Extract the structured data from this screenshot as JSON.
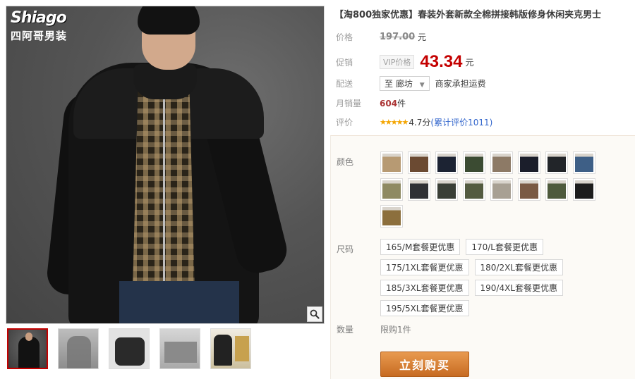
{
  "gallery": {
    "logo_mark": "Shiago",
    "logo_cn": "四阿哥男装",
    "zoom_icon": "magnifier-icon",
    "thumbnails": [
      "thumb-1",
      "thumb-2",
      "thumb-3",
      "thumb-4",
      "thumb-5"
    ],
    "active_thumb": 0
  },
  "product": {
    "title": "【淘800独家优惠】春装外套新款全棉拼接韩版修身休闲夹克男士",
    "price_label": "价格",
    "original_price": "197.00",
    "currency_unit": "元",
    "promo_label": "促销",
    "vip_tag": "VIP价格",
    "promo_price": "43.34",
    "ship_label": "配送",
    "ship_prefix": "至",
    "ship_dest": "廊坊",
    "ship_note": "商家承担运费",
    "sales_label": "月销量",
    "sales_count": "604",
    "sales_unit": "件",
    "rating_label": "评价",
    "stars": "★★★★★",
    "score": "4.7分",
    "review_text": "(累计评价1011)"
  },
  "sku": {
    "color_label": "颜色",
    "swatch_colors": [
      "#b79a73",
      "#6b4a32",
      "#1c2333",
      "#3b4b32",
      "#8d7a66",
      "#1b1e2b",
      "#222529",
      "#3e5f86",
      "#8f8a63",
      "#2f3135",
      "#3a3f36",
      "#545b40",
      "#a8a093",
      "#7a5a44",
      "#4e5a3c",
      "#1d1d1d",
      "#8c6f3d"
    ],
    "size_label": "尺码",
    "sizes": [
      "165/M套餐更优惠",
      "170/L套餐更优惠",
      "175/1XL套餐更优惠",
      "180/2XL套餐更优惠",
      "185/3XL套餐更优惠",
      "190/4XL套餐更优惠",
      "195/5XL套餐更优惠"
    ],
    "qty_label": "数量",
    "qty_limit": "限购1件",
    "buy_label": "立刻购买"
  },
  "colors": {
    "accent_red": "#c40000",
    "buy_button": "#d9822b"
  }
}
